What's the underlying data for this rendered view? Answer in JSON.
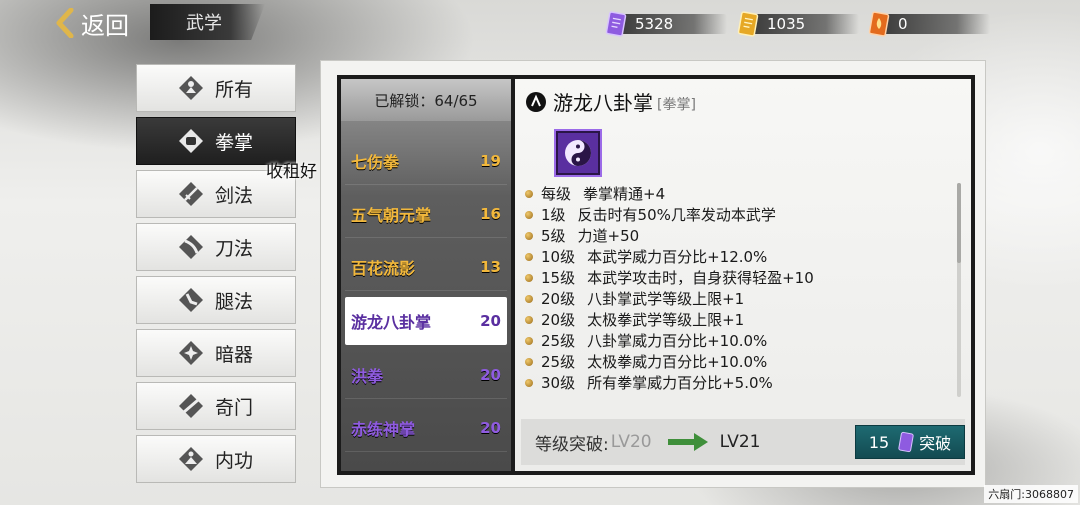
{
  "header": {
    "back_label": "返回",
    "title": "武学"
  },
  "currencies": [
    {
      "icon": "purple-scroll-icon",
      "value": "5328",
      "color": "#8e5be0"
    },
    {
      "icon": "gold-scroll-icon",
      "value": "1035",
      "color": "#e6a825"
    },
    {
      "icon": "flame-scroll-icon",
      "value": "0",
      "color": "#e36b1d"
    }
  ],
  "tabs": [
    {
      "label": "所有",
      "icon": "all-icon",
      "active": false
    },
    {
      "label": "拳掌",
      "icon": "fist-icon",
      "active": true
    },
    {
      "label": "剑法",
      "icon": "sword-icon",
      "active": false
    },
    {
      "label": "刀法",
      "icon": "blade-icon",
      "active": false
    },
    {
      "label": "腿法",
      "icon": "kick-icon",
      "active": false
    },
    {
      "label": "暗器",
      "icon": "shuriken-icon",
      "active": false
    },
    {
      "label": "奇门",
      "icon": "staff-icon",
      "active": false
    },
    {
      "label": "内功",
      "icon": "meditation-icon",
      "active": false
    }
  ],
  "nickname": "收租好",
  "skill_list": {
    "unlock_text": "已解锁：64/65",
    "items": [
      {
        "name": "七伤拳",
        "level": "19",
        "selected": false,
        "color": "gold"
      },
      {
        "name": "五气朝元掌",
        "level": "16",
        "selected": false,
        "color": "gold"
      },
      {
        "name": "百花流影",
        "level": "13",
        "selected": false,
        "color": "gold"
      },
      {
        "name": "游龙八卦掌",
        "level": "20",
        "selected": true,
        "color": "purple"
      },
      {
        "name": "洪拳",
        "level": "20",
        "selected": false,
        "color": "purple"
      },
      {
        "name": "赤练神掌",
        "level": "20",
        "selected": false,
        "color": "purple"
      }
    ]
  },
  "detail": {
    "name": "游龙八卦掌",
    "type": "[拳掌]",
    "icon": "yin-yang-skill-icon",
    "effects": [
      {
        "level": "每级",
        "text": "拳掌精通+4"
      },
      {
        "level": "1级",
        "text": "反击时有50%几率发动本武学"
      },
      {
        "level": "5级",
        "text": "力道+50"
      },
      {
        "level": "10级",
        "text": "本武学威力百分比+12.0%"
      },
      {
        "level": "15级",
        "text": "本武学攻击时，自身获得轻盈+10"
      },
      {
        "level": "20级",
        "text": "八卦掌武学等级上限+1"
      },
      {
        "level": "20级",
        "text": "太极拳武学等级上限+1"
      },
      {
        "level": "25级",
        "text": "八卦掌威力百分比+10.0%"
      },
      {
        "level": "25级",
        "text": "太极拳威力百分比+10.0%"
      },
      {
        "level": "30级",
        "text": "所有拳掌威力百分比+5.0%"
      }
    ],
    "breakthrough": {
      "label": "等级突破:",
      "from": "LV20",
      "to": "LV21",
      "cost": "15",
      "button_label": "突破"
    }
  },
  "footer_id": "六扇门:3068807"
}
